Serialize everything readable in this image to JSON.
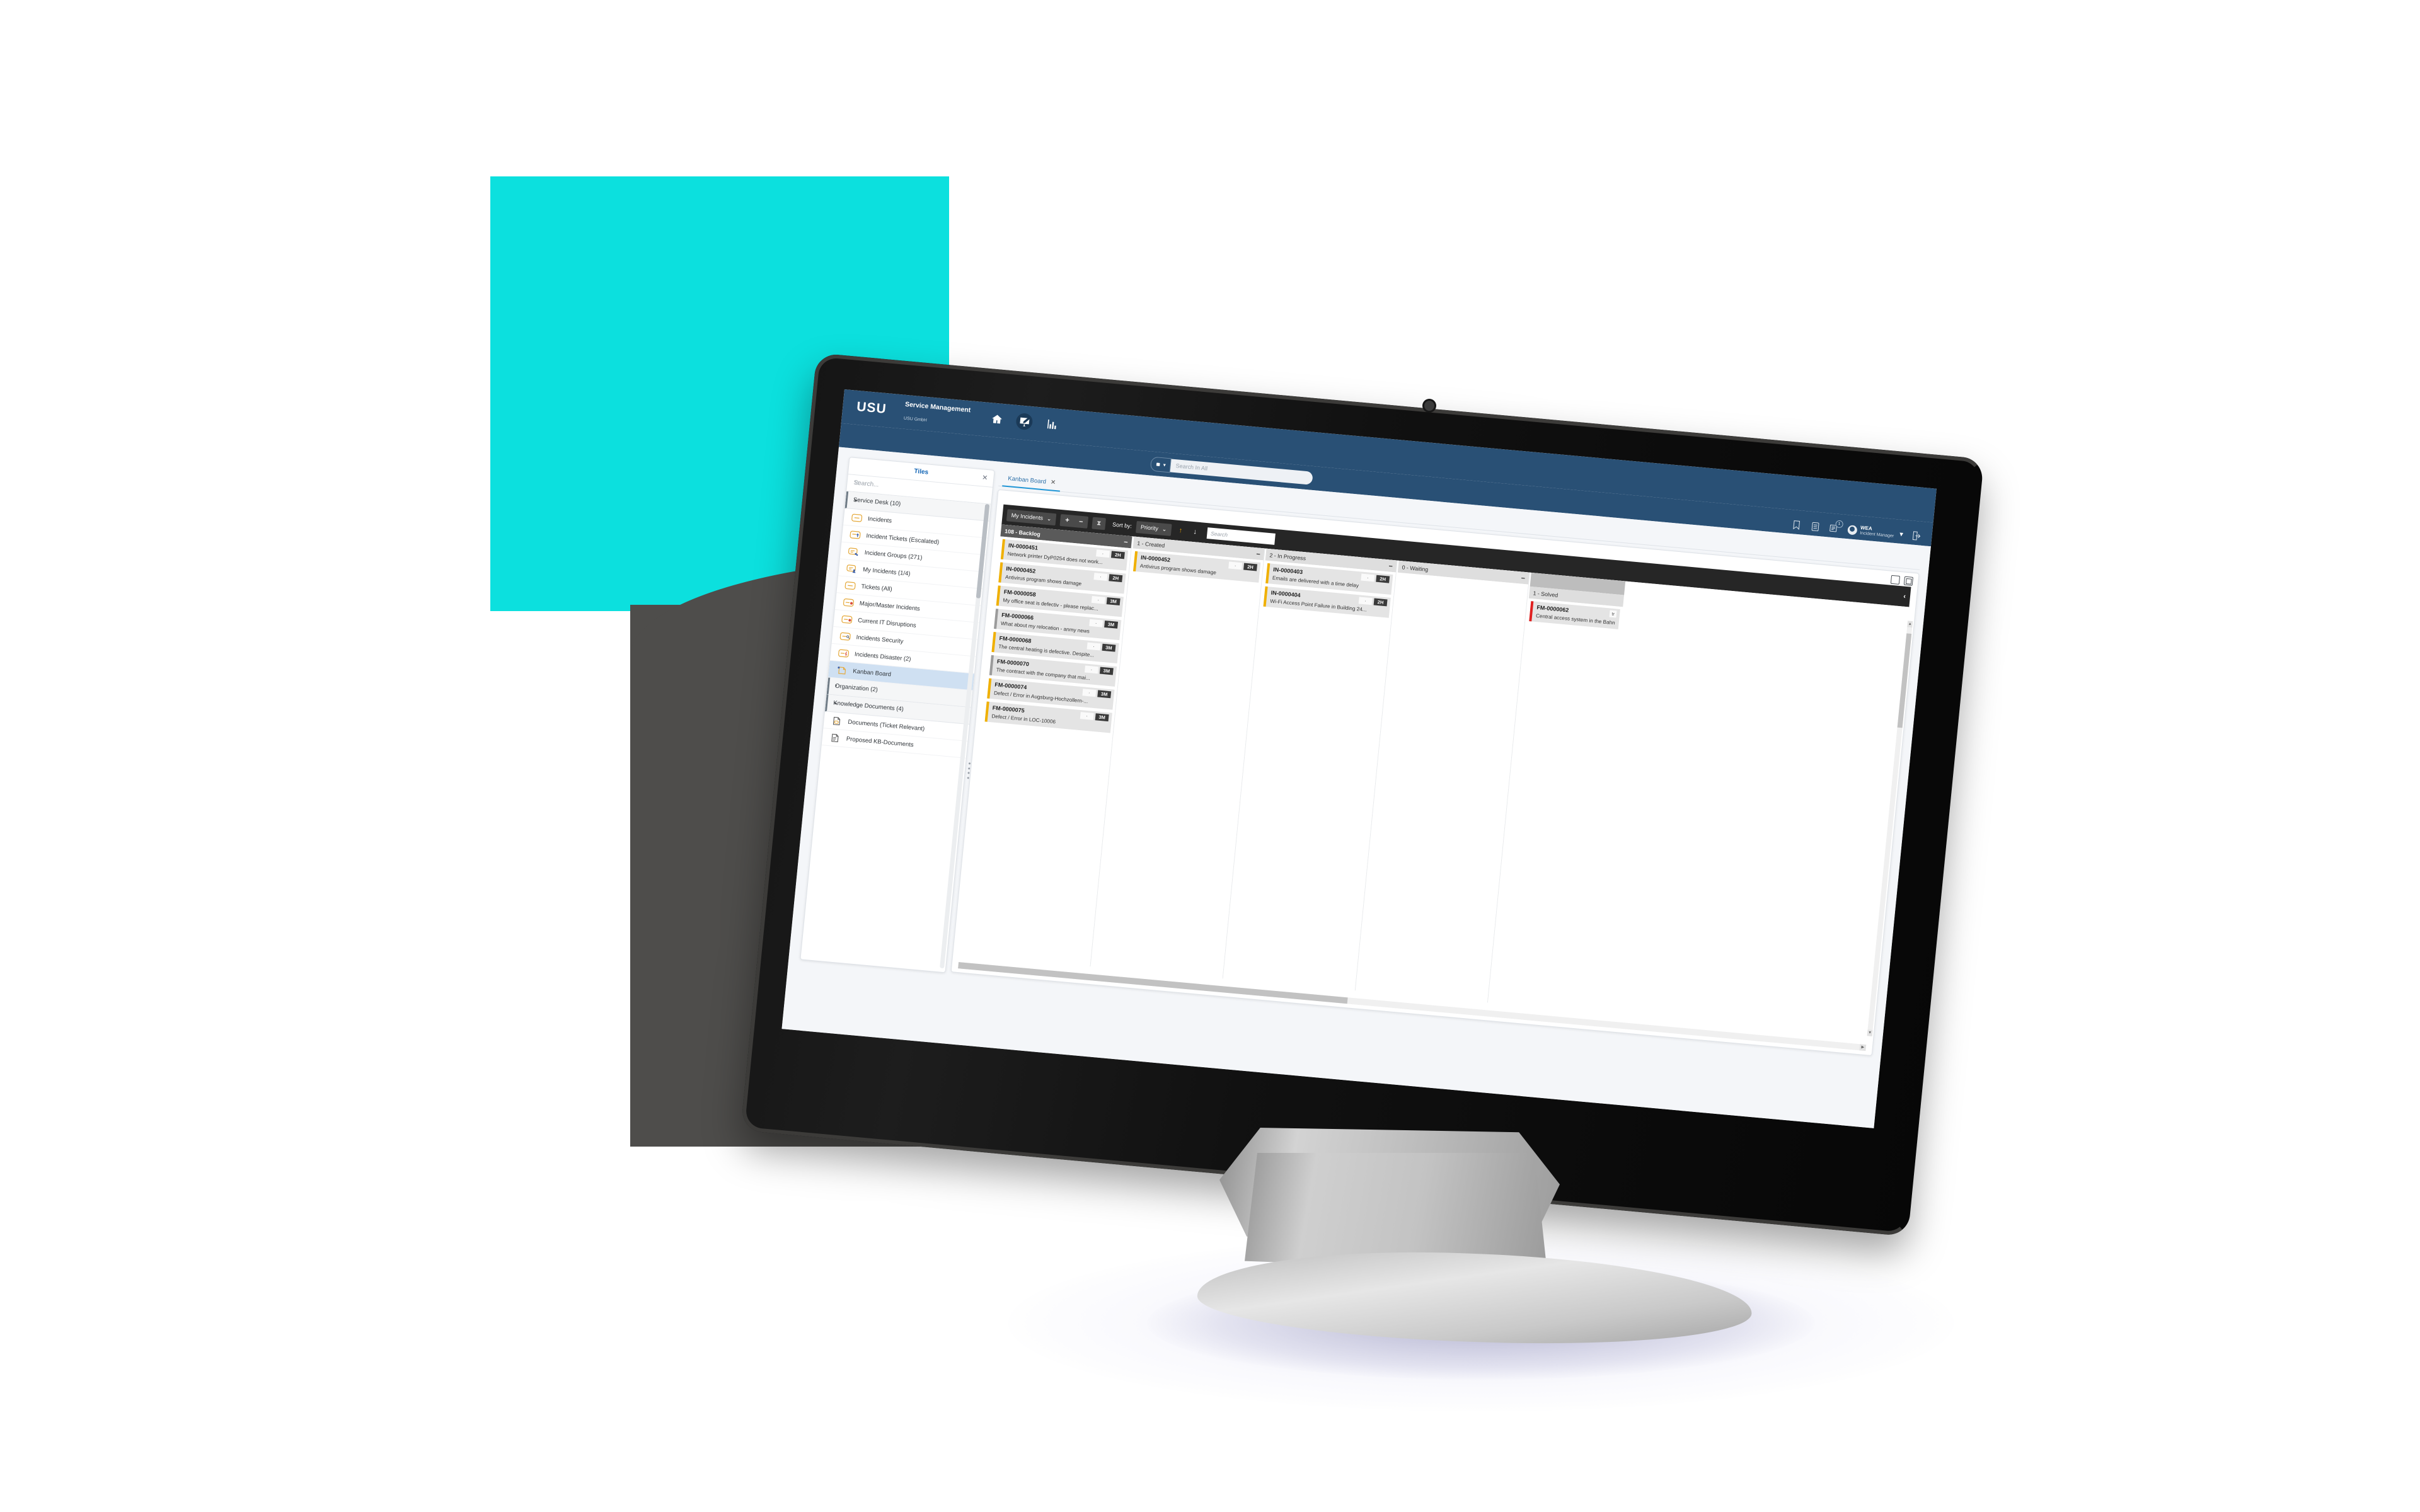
{
  "brand": {
    "logo": "USU",
    "title": "Service Management",
    "subtitle": "USU GmbH",
    "nav_icons": [
      "home-icon",
      "workspace-icon",
      "reports-icon"
    ],
    "accent_color": "#295075"
  },
  "search": {
    "placeholder": "Search In All",
    "value": "",
    "prefix_icon": "scope-icon"
  },
  "user": {
    "name": "WEA",
    "role": "Incident Manager",
    "notification_count": "1",
    "icons": [
      "bookmark-icon",
      "list-icon",
      "news-icon"
    ],
    "logout_icon": "logout-icon"
  },
  "tiles": {
    "title": "Tiles",
    "close_label": "✕",
    "search_placeholder": "Search...",
    "search_clear": "✕",
    "groups": [
      {
        "label": "Service Desk (10)",
        "chevron": "⌄",
        "expanded": true,
        "items": [
          {
            "label": "Incidents",
            "icon": "ticket-icon",
            "selected": false
          },
          {
            "label": "Incident Tickets (Escalated)",
            "icon": "ticket-escalated-icon",
            "selected": false
          },
          {
            "label": "Incident Groups (271)",
            "icon": "ticket-group-icon",
            "selected": false
          },
          {
            "label": "My Incidents (1/4)",
            "icon": "ticket-user-icon",
            "selected": false
          },
          {
            "label": "Tickets (All)",
            "icon": "ticket-icon",
            "selected": false
          },
          {
            "label": "Major/Master Incidents",
            "icon": "ticket-major-icon",
            "selected": false
          },
          {
            "label": "Current IT Disruptions",
            "icon": "ticket-major-icon",
            "selected": false
          },
          {
            "label": "Incidents Security",
            "icon": "ticket-security-icon",
            "selected": false
          },
          {
            "label": "Incidents Disaster (2)",
            "icon": "ticket-disaster-icon",
            "selected": false
          },
          {
            "label": "Kanban Board",
            "icon": "kanban-icon",
            "selected": true
          }
        ]
      },
      {
        "label": "Organization (2)",
        "chevron": "›",
        "expanded": false,
        "items": []
      },
      {
        "label": "Knowledge Documents (4)",
        "chevron": "⌄",
        "expanded": true,
        "items": [
          {
            "label": "Documents (Ticket Relevant)",
            "icon": "document-ticket-icon",
            "selected": false
          },
          {
            "label": "Proposed KB-Documents",
            "icon": "document-kb-icon",
            "selected": false
          }
        ]
      }
    ]
  },
  "tab": {
    "label": "Kanban Board",
    "close": "✕"
  },
  "board_tools": {
    "icons": [
      "maximize-icon",
      "duplicate-icon"
    ]
  },
  "kanban_toolbar": {
    "view_select": "My Incidents",
    "view_chevron": "⌄",
    "add_label": "+",
    "remove_label": "–",
    "refresh_icon": "refresh-icon",
    "sort_label": "Sort by:",
    "sort_value": "Priority",
    "sort_chevron": "⌄",
    "sort_asc": "↑",
    "sort_desc": "↓",
    "search_placeholder": "Search",
    "collapse_icon": "‹"
  },
  "columns": [
    {
      "title": "108 - Backlog",
      "style": "dark",
      "minimize": "–",
      "cards": [
        {
          "id": "IN-0000451",
          "text": "Network printer DyP0254 does not work...",
          "dot": "·",
          "time": "2H",
          "accent": "yellow"
        },
        {
          "id": "IN-0000452",
          "text": "Antivirus program shows damage",
          "dot": "·",
          "time": "2H",
          "accent": "yellow"
        },
        {
          "id": "FM-0000058",
          "text": "My office seat is defectiv - please replac...",
          "dot": "·",
          "time": "3M",
          "accent": "yellow"
        },
        {
          "id": "FM-0000066",
          "text": "What about my relocation - anmy news",
          "dot": "·",
          "time": "3M",
          "accent": "grey"
        },
        {
          "id": "FM-0000068",
          "text": "The central heating is defective. Despite...",
          "dot": "·",
          "time": "3M",
          "accent": "yellow"
        },
        {
          "id": "FM-0000070",
          "text": "The contract with the company that mai...",
          "dot": "·",
          "time": "3M",
          "accent": "grey"
        },
        {
          "id": "FM-0000074",
          "text": "Defect / Error in Augsburg-Hochzollern-...",
          "dot": "·",
          "time": "3M",
          "accent": "yellow"
        },
        {
          "id": "FM-0000075",
          "text": "Defect / Error in LOC-10006",
          "dot": "·",
          "time": "3M",
          "accent": "yellow"
        }
      ]
    },
    {
      "title": "1 - Created",
      "style": "light",
      "minimize": "–",
      "cards": [
        {
          "id": "IN-0000452",
          "text": "Antivirus program shows damage",
          "dot": "·",
          "time": "2H",
          "accent": "yellow"
        }
      ]
    },
    {
      "title": "2 - In Progress",
      "style": "light",
      "minimize": "–",
      "cards": [
        {
          "id": "IN-0000403",
          "text": "Emails are delivered with a time delay",
          "dot": "·",
          "time": "2H",
          "accent": "yellow"
        },
        {
          "id": "IN-0000404",
          "text": "Wi-Fi Access Point Failure in Building 24...",
          "dot": "·",
          "time": "2H",
          "accent": "yellow"
        }
      ]
    },
    {
      "title": "0 - Waiting",
      "style": "light",
      "minimize": "–",
      "cards": []
    },
    {
      "title": "1 - Solved",
      "style": "light",
      "minimize": "",
      "cards": [
        {
          "id": "FM-0000062",
          "text": "Central access system in the Bahnh",
          "dot": "tr",
          "time": "",
          "accent": "red"
        }
      ]
    }
  ],
  "colors": {
    "brand_blue": "#295075",
    "teal_square": "#0ce0de",
    "card_accent_yellow": "#f0b000",
    "card_accent_grey": "#9b9b9b",
    "card_accent_red": "#e02020",
    "toolbar_dark": "#262626",
    "selected_tile": "#cfe0f2"
  }
}
